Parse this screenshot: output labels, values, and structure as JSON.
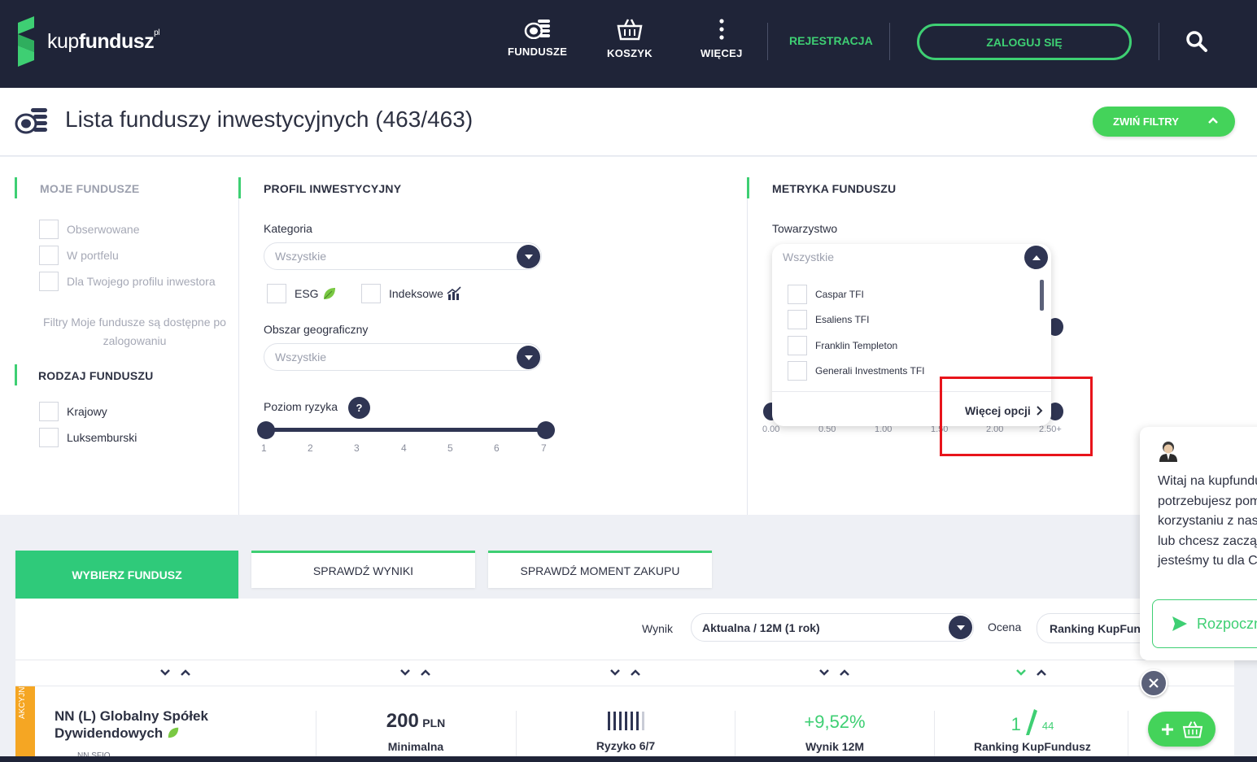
{
  "brand": {
    "name_light": "kup",
    "name_bold": "fundusz",
    "suffix": "pl"
  },
  "nav": {
    "items": [
      {
        "label": "FUNDUSZE",
        "icon": "coins-icon"
      },
      {
        "label": "KOSZYK",
        "icon": "basket-icon"
      },
      {
        "label": "WIĘCEJ",
        "icon": "more-vertical-icon"
      }
    ],
    "register": "REJESTRACJA",
    "login": "ZALOGUJ SIĘ",
    "search_icon": "search-icon"
  },
  "header": {
    "title": "Lista funduszy inwestycyjnych (463/463)",
    "collapse_filters": "ZWIŃ FILTRY"
  },
  "filters": {
    "my_funds": {
      "title": "MOJE FUNDUSZE",
      "options": [
        "Obserwowane",
        "W portfelu",
        "Dla Twojego profilu inwestora"
      ],
      "note": "Filtry Moje fundusze są dostępne po zalogowaniu"
    },
    "fund_type": {
      "title": "RODZAJ FUNDUSZU",
      "options": [
        "Krajowy",
        "Luksemburski"
      ]
    },
    "profile": {
      "title": "PROFIL INWESTYCYJNY",
      "category_label": "Kategoria",
      "category_value": "Wszystkie",
      "esg_label": "ESG",
      "index_label": "Indeksowe",
      "geo_label": "Obszar geograficzny",
      "geo_value": "Wszystkie",
      "risk_label": "Poziom ryzyka",
      "risk_help": "?",
      "risk_ticks": [
        "1",
        "2",
        "3",
        "4",
        "5",
        "6",
        "7"
      ],
      "risk_range": [
        1,
        7
      ]
    },
    "metrics": {
      "title": "METRYKA FUNDUSZU",
      "company_label": "Towarzystwo",
      "company_value": "Wszystkie",
      "company_options": [
        "Caspar TFI",
        "Esaliens TFI",
        "Franklin Templeton",
        "Generali Investments TFI"
      ],
      "more_options": "Więcej opcji",
      "slider_ticks": [
        "0.00",
        "0.50",
        "1.00",
        "1.50",
        "2.00",
        "2.50+"
      ]
    }
  },
  "tabs": [
    "WYBIERZ FUNDUSZ",
    "SPRAWDŹ WYNIKI",
    "SPRAWDŹ MOMENT ZAKUPU"
  ],
  "results": {
    "result_label": "Wynik",
    "result_value": "Aktualna / 12M (1 rok)",
    "rating_label": "Ocena",
    "rating_value": "Ranking KupFundusz"
  },
  "fund": {
    "category": "AKCYJNY",
    "name": "NN (L) Globalny Spółek Dywidendowych",
    "tfi": "NN SFIO",
    "min_value": "200",
    "min_unit": "PLN",
    "min_caption": "Minimalna",
    "risk_level": 6,
    "risk_max": 7,
    "risk_caption": "Ryzyko 6/7",
    "result": "+9,52%",
    "result_caption": "Wynik 12M",
    "rank": "1",
    "rank_total": "44",
    "rank_caption": "Ranking KupFundusz"
  },
  "chat": {
    "lines": [
      "Witaj na kupfundusz.pl! Jeśli",
      "potrzebujesz pomocy w",
      "korzystaniu z naszego serwisu",
      "lub chcesz zacząć inwestować,",
      "jesteśmy tu dla Ciebie."
    ],
    "button": "Rozpocznij"
  },
  "colors": {
    "navy": "#1f2438",
    "green": "#3ecf73",
    "accent_orange": "#f5a623",
    "highlight_red": "#e8141b"
  }
}
